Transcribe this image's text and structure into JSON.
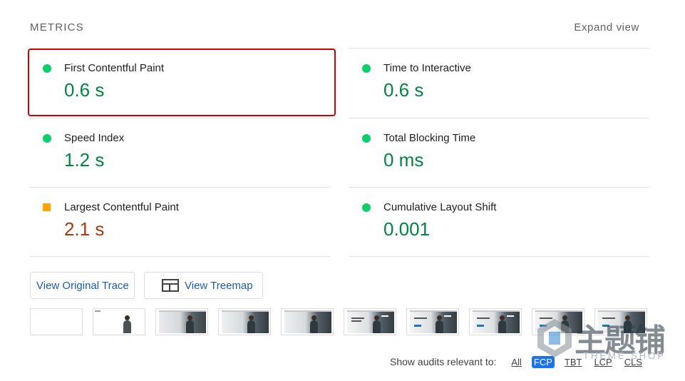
{
  "header": {
    "title": "METRICS",
    "expand_label": "Expand view"
  },
  "metrics": [
    {
      "label": "First Contentful Paint",
      "value": "0.6 s",
      "status": "pass"
    },
    {
      "label": "Time to Interactive",
      "value": "0.6 s",
      "status": "pass"
    },
    {
      "label": "Speed Index",
      "value": "1.2 s",
      "status": "pass"
    },
    {
      "label": "Total Blocking Time",
      "value": "0 ms",
      "status": "pass"
    },
    {
      "label": "Largest Contentful Paint",
      "value": "2.1 s",
      "status": "average"
    },
    {
      "label": "Cumulative Layout Shift",
      "value": "0.001",
      "status": "pass"
    }
  ],
  "buttons": {
    "view_trace": "View Original Trace",
    "view_treemap": "View Treemap",
    "treemap_icon": "treemap-icon"
  },
  "filmstrip": {
    "frame_count": 10
  },
  "footer": {
    "lead": "Show audits relevant to:",
    "filters": [
      {
        "label": "All",
        "active": false
      },
      {
        "label": "FCP",
        "active": true
      },
      {
        "label": "TBT",
        "active": false
      },
      {
        "label": "LCP",
        "active": false
      },
      {
        "label": "CLS",
        "active": false
      }
    ]
  },
  "watermark": {
    "cn_text": "主题铺",
    "en_text": "THEME SHOP"
  },
  "colors": {
    "pass": "#0cce6b",
    "pass_value": "#018642",
    "average": "#ffa400",
    "average_value": "#a63b11",
    "highlight": "#d50000",
    "link": "#1a5ab8",
    "accent": "#1a73e8"
  }
}
